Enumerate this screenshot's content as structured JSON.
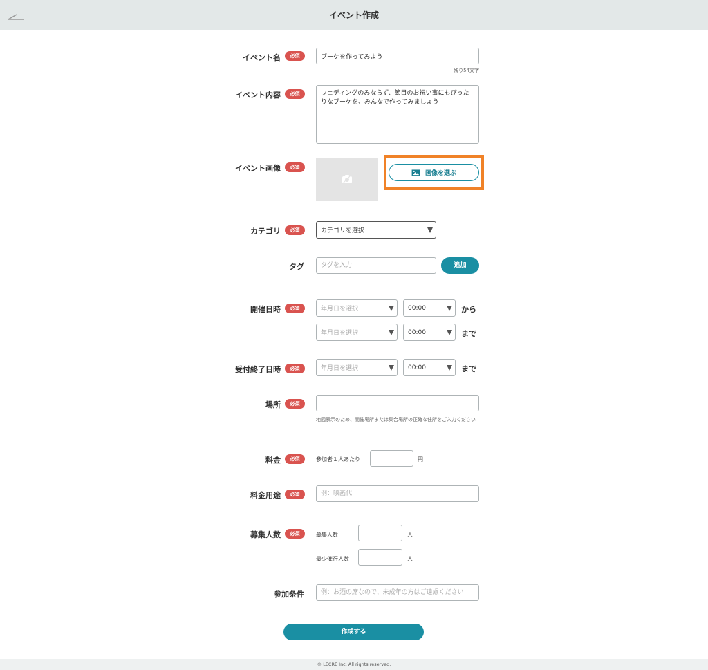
{
  "header": {
    "title": "イベント作成",
    "back_icon": "back-arrow-icon"
  },
  "required_badge": "必須",
  "colors": {
    "accent": "#1a8fa3",
    "required": "#d9534f",
    "highlight": "#f08228",
    "header_bg": "#e3e8e8"
  },
  "fields": {
    "event_name": {
      "label": "イベント名",
      "value": "ブーケを作ってみよう",
      "remaining": "残り54文字"
    },
    "event_content": {
      "label": "イベント内容",
      "value": "ウェディングのみならず、節目のお祝い事にもぴったりなブーケを、みんなで作ってみましょう"
    },
    "event_image": {
      "label": "イベント画像",
      "placeholder_icon": "camera-icon",
      "choose_button": "画像を選ぶ",
      "choose_icon": "image-icon"
    },
    "category": {
      "label": "カテゴリ",
      "selected": "カテゴリを選択"
    },
    "tag": {
      "label": "タグ",
      "placeholder": "タグを入力",
      "add_button": "追加"
    },
    "event_datetime": {
      "label": "開催日時",
      "start_date": "年月日を選択",
      "start_time": "00:00",
      "from": "から",
      "end_date": "年月日を選択",
      "end_time": "00:00",
      "until": "まで"
    },
    "deadline": {
      "label": "受付終了日時",
      "date": "年月日を選択",
      "time": "00:00",
      "until": "まで"
    },
    "location": {
      "label": "場所",
      "value": "",
      "note": "地図表示のため、開催場所または集合場所の正確な住所をご入力ください"
    },
    "fee": {
      "label": "料金",
      "prefix": "参加者１人あたり",
      "value": "",
      "unit": "円"
    },
    "fee_usage": {
      "label": "料金用途",
      "placeholder": "例：映画代"
    },
    "capacity": {
      "label": "募集人数",
      "recruit_label": "募集人数",
      "recruit_value": "",
      "recruit_unit": "人",
      "min_label": "最少催行人数",
      "min_value": "",
      "min_unit": "人"
    },
    "conditions": {
      "label": "参加条件",
      "placeholder": "例：お酒の席なので、未成年の方はご遠慮ください"
    }
  },
  "submit_button": "作成する",
  "footer": "© LECRE Inc. All rights reserved."
}
